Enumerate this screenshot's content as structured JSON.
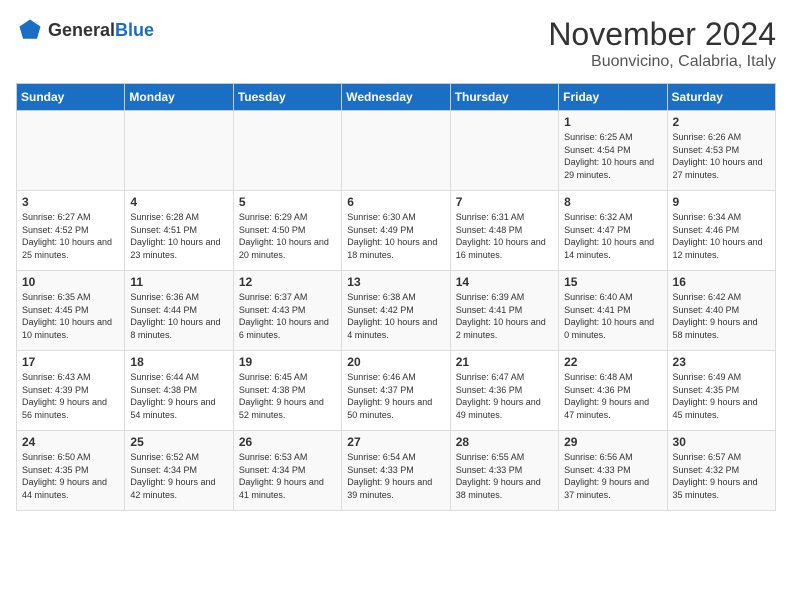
{
  "header": {
    "logo_general": "General",
    "logo_blue": "Blue",
    "title": "November 2024",
    "subtitle": "Buonvicino, Calabria, Italy"
  },
  "days_of_week": [
    "Sunday",
    "Monday",
    "Tuesday",
    "Wednesday",
    "Thursday",
    "Friday",
    "Saturday"
  ],
  "weeks": [
    [
      {
        "day": "",
        "info": ""
      },
      {
        "day": "",
        "info": ""
      },
      {
        "day": "",
        "info": ""
      },
      {
        "day": "",
        "info": ""
      },
      {
        "day": "",
        "info": ""
      },
      {
        "day": "1",
        "info": "Sunrise: 6:25 AM\nSunset: 4:54 PM\nDaylight: 10 hours and 29 minutes."
      },
      {
        "day": "2",
        "info": "Sunrise: 6:26 AM\nSunset: 4:53 PM\nDaylight: 10 hours and 27 minutes."
      }
    ],
    [
      {
        "day": "3",
        "info": "Sunrise: 6:27 AM\nSunset: 4:52 PM\nDaylight: 10 hours and 25 minutes."
      },
      {
        "day": "4",
        "info": "Sunrise: 6:28 AM\nSunset: 4:51 PM\nDaylight: 10 hours and 23 minutes."
      },
      {
        "day": "5",
        "info": "Sunrise: 6:29 AM\nSunset: 4:50 PM\nDaylight: 10 hours and 20 minutes."
      },
      {
        "day": "6",
        "info": "Sunrise: 6:30 AM\nSunset: 4:49 PM\nDaylight: 10 hours and 18 minutes."
      },
      {
        "day": "7",
        "info": "Sunrise: 6:31 AM\nSunset: 4:48 PM\nDaylight: 10 hours and 16 minutes."
      },
      {
        "day": "8",
        "info": "Sunrise: 6:32 AM\nSunset: 4:47 PM\nDaylight: 10 hours and 14 minutes."
      },
      {
        "day": "9",
        "info": "Sunrise: 6:34 AM\nSunset: 4:46 PM\nDaylight: 10 hours and 12 minutes."
      }
    ],
    [
      {
        "day": "10",
        "info": "Sunrise: 6:35 AM\nSunset: 4:45 PM\nDaylight: 10 hours and 10 minutes."
      },
      {
        "day": "11",
        "info": "Sunrise: 6:36 AM\nSunset: 4:44 PM\nDaylight: 10 hours and 8 minutes."
      },
      {
        "day": "12",
        "info": "Sunrise: 6:37 AM\nSunset: 4:43 PM\nDaylight: 10 hours and 6 minutes."
      },
      {
        "day": "13",
        "info": "Sunrise: 6:38 AM\nSunset: 4:42 PM\nDaylight: 10 hours and 4 minutes."
      },
      {
        "day": "14",
        "info": "Sunrise: 6:39 AM\nSunset: 4:41 PM\nDaylight: 10 hours and 2 minutes."
      },
      {
        "day": "15",
        "info": "Sunrise: 6:40 AM\nSunset: 4:41 PM\nDaylight: 10 hours and 0 minutes."
      },
      {
        "day": "16",
        "info": "Sunrise: 6:42 AM\nSunset: 4:40 PM\nDaylight: 9 hours and 58 minutes."
      }
    ],
    [
      {
        "day": "17",
        "info": "Sunrise: 6:43 AM\nSunset: 4:39 PM\nDaylight: 9 hours and 56 minutes."
      },
      {
        "day": "18",
        "info": "Sunrise: 6:44 AM\nSunset: 4:38 PM\nDaylight: 9 hours and 54 minutes."
      },
      {
        "day": "19",
        "info": "Sunrise: 6:45 AM\nSunset: 4:38 PM\nDaylight: 9 hours and 52 minutes."
      },
      {
        "day": "20",
        "info": "Sunrise: 6:46 AM\nSunset: 4:37 PM\nDaylight: 9 hours and 50 minutes."
      },
      {
        "day": "21",
        "info": "Sunrise: 6:47 AM\nSunset: 4:36 PM\nDaylight: 9 hours and 49 minutes."
      },
      {
        "day": "22",
        "info": "Sunrise: 6:48 AM\nSunset: 4:36 PM\nDaylight: 9 hours and 47 minutes."
      },
      {
        "day": "23",
        "info": "Sunrise: 6:49 AM\nSunset: 4:35 PM\nDaylight: 9 hours and 45 minutes."
      }
    ],
    [
      {
        "day": "24",
        "info": "Sunrise: 6:50 AM\nSunset: 4:35 PM\nDaylight: 9 hours and 44 minutes."
      },
      {
        "day": "25",
        "info": "Sunrise: 6:52 AM\nSunset: 4:34 PM\nDaylight: 9 hours and 42 minutes."
      },
      {
        "day": "26",
        "info": "Sunrise: 6:53 AM\nSunset: 4:34 PM\nDaylight: 9 hours and 41 minutes."
      },
      {
        "day": "27",
        "info": "Sunrise: 6:54 AM\nSunset: 4:33 PM\nDaylight: 9 hours and 39 minutes."
      },
      {
        "day": "28",
        "info": "Sunrise: 6:55 AM\nSunset: 4:33 PM\nDaylight: 9 hours and 38 minutes."
      },
      {
        "day": "29",
        "info": "Sunrise: 6:56 AM\nSunset: 4:33 PM\nDaylight: 9 hours and 37 minutes."
      },
      {
        "day": "30",
        "info": "Sunrise: 6:57 AM\nSunset: 4:32 PM\nDaylight: 9 hours and 35 minutes."
      }
    ]
  ]
}
